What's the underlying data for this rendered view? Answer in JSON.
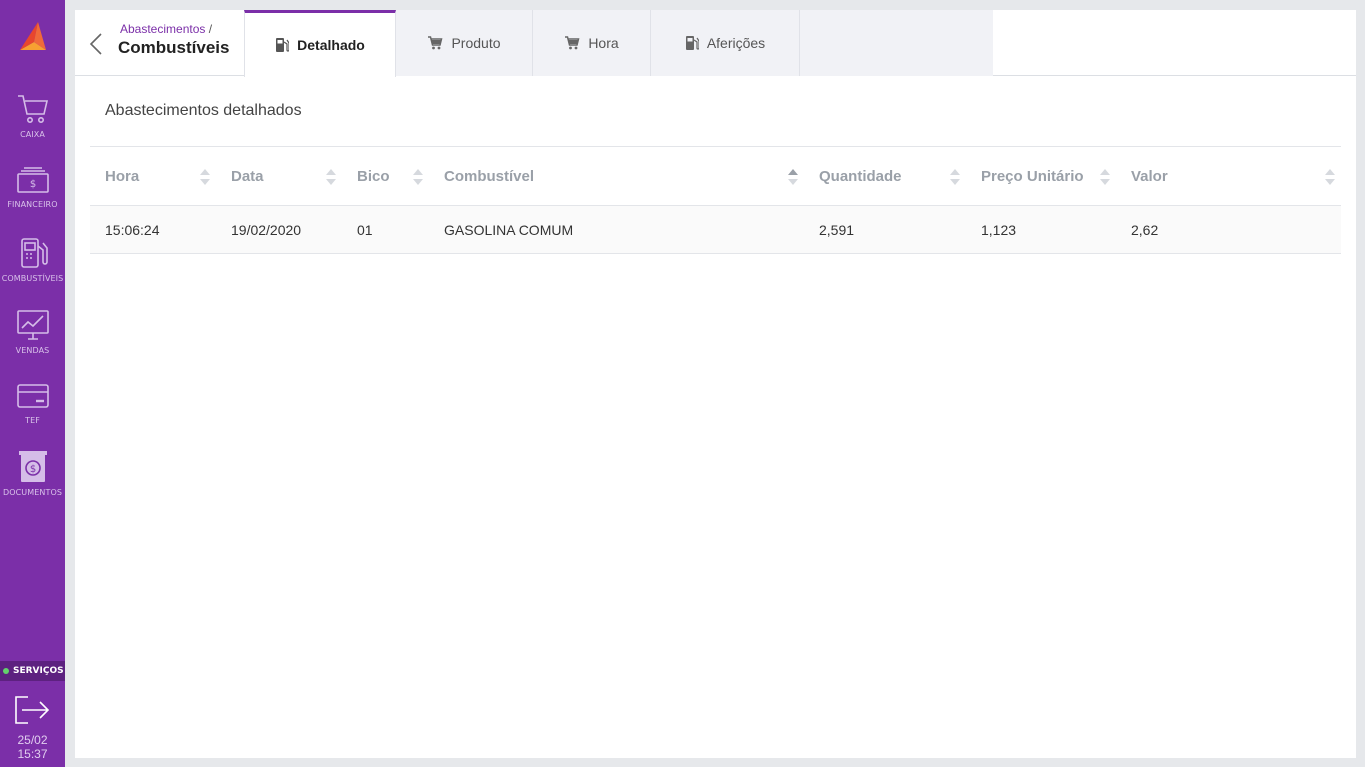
{
  "sidebar": {
    "items": [
      {
        "label": "CAIXA",
        "icon": "cart-icon"
      },
      {
        "label": "FINANCEIRO",
        "icon": "money-icon"
      },
      {
        "label": "COMBUSTÍVEIS",
        "icon": "fuel-pump-icon"
      },
      {
        "label": "VENDAS",
        "icon": "chart-monitor-icon"
      },
      {
        "label": "TEF",
        "icon": "credit-card-icon"
      },
      {
        "label": "DOCUMENTOS",
        "icon": "document-dollar-icon"
      }
    ],
    "services_label": "SERVIÇOS",
    "date": "25/02",
    "time": "15:37"
  },
  "header": {
    "breadcrumb_parent": "Abastecimentos",
    "breadcrumb_sep": "/",
    "title": "Combustíveis"
  },
  "tabs": [
    {
      "label": "Detalhado",
      "icon": "fuel-icon",
      "active": true
    },
    {
      "label": "Produto",
      "icon": "cart-icon",
      "active": false
    },
    {
      "label": "Hora",
      "icon": "cart-icon",
      "active": false
    },
    {
      "label": "Aferições",
      "icon": "fuel-icon",
      "active": false
    }
  ],
  "section_title": "Abastecimentos detalhados",
  "table": {
    "columns": [
      "Hora",
      "Data",
      "Bico",
      "Combustível",
      "Quantidade",
      "Preço Unitário",
      "Valor"
    ],
    "rows": [
      [
        "15:06:24",
        "19/02/2020",
        "01",
        "GASOLINA COMUM",
        "2,591",
        "1,123",
        "2,62"
      ]
    ]
  },
  "colors": {
    "accent": "#7b2fa8",
    "sidebar_bg": "#7b2fa8",
    "status_online": "#63d16c"
  }
}
